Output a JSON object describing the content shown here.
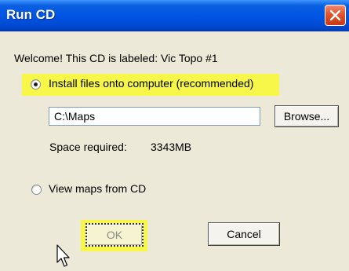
{
  "window": {
    "title": "Run CD",
    "close_icon": "close-icon"
  },
  "welcome_text": "Welcome! This CD is labeled: Vic Topo #1",
  "install_option": {
    "label": "Install files onto computer (recommended)",
    "selected": true
  },
  "path_field": {
    "value": "C:\\Maps"
  },
  "browse_button": {
    "label": "Browse..."
  },
  "space": {
    "label": "Space required:",
    "value": "3343MB"
  },
  "view_option": {
    "label": "View maps from CD",
    "selected": false
  },
  "ok_button": {
    "label": "OK"
  },
  "cancel_button": {
    "label": "Cancel"
  },
  "colors": {
    "title_bar": "#0055e5",
    "highlight": "#f7f74a",
    "dialog_bg": "#ece9d8",
    "close_button": "#e0542c"
  }
}
